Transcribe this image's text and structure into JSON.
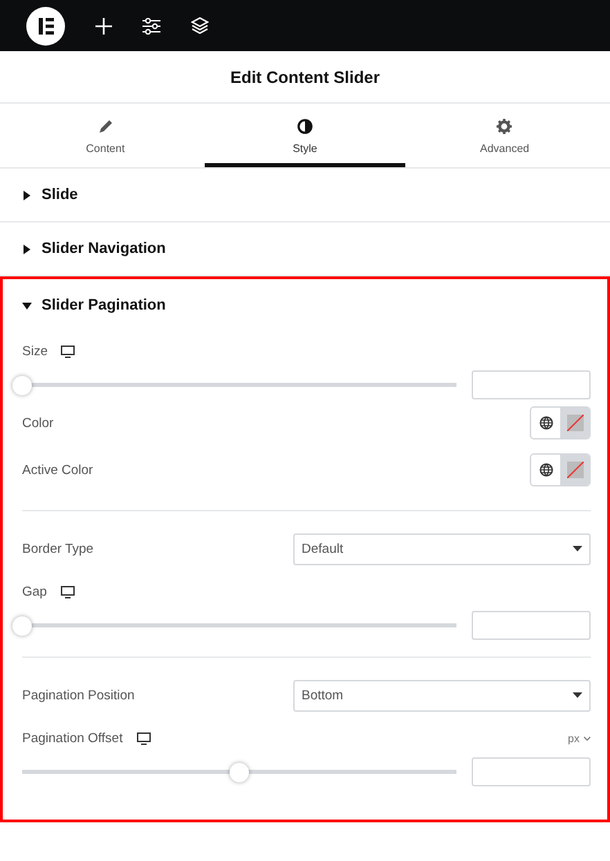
{
  "title": "Edit Content Slider",
  "tabs": [
    {
      "label": "Content",
      "selected": false
    },
    {
      "label": "Style",
      "selected": true
    },
    {
      "label": "Advanced",
      "selected": false
    }
  ],
  "sections": [
    {
      "title": "Slide",
      "expanded": false,
      "highlighted": false
    },
    {
      "title": "Slider Navigation",
      "expanded": false,
      "highlighted": false
    },
    {
      "title": "Slider Pagination",
      "expanded": true,
      "highlighted": true,
      "controls": [
        {
          "kind": "slider",
          "label": "Size",
          "responsive": true,
          "level": 0
        },
        {
          "kind": "color",
          "label": "Color"
        },
        {
          "kind": "color",
          "label": "Active Color"
        },
        {
          "kind": "divider"
        },
        {
          "kind": "select",
          "label": "Border Type",
          "value": "Default"
        },
        {
          "kind": "slider",
          "label": "Gap",
          "responsive": true,
          "level": 0
        },
        {
          "kind": "divider"
        },
        {
          "kind": "select",
          "label": "Pagination Position",
          "value": "Bottom"
        },
        {
          "kind": "slider",
          "label": "Pagination Offset",
          "responsive": true,
          "unit": "px",
          "level": 0.5
        }
      ]
    }
  ]
}
